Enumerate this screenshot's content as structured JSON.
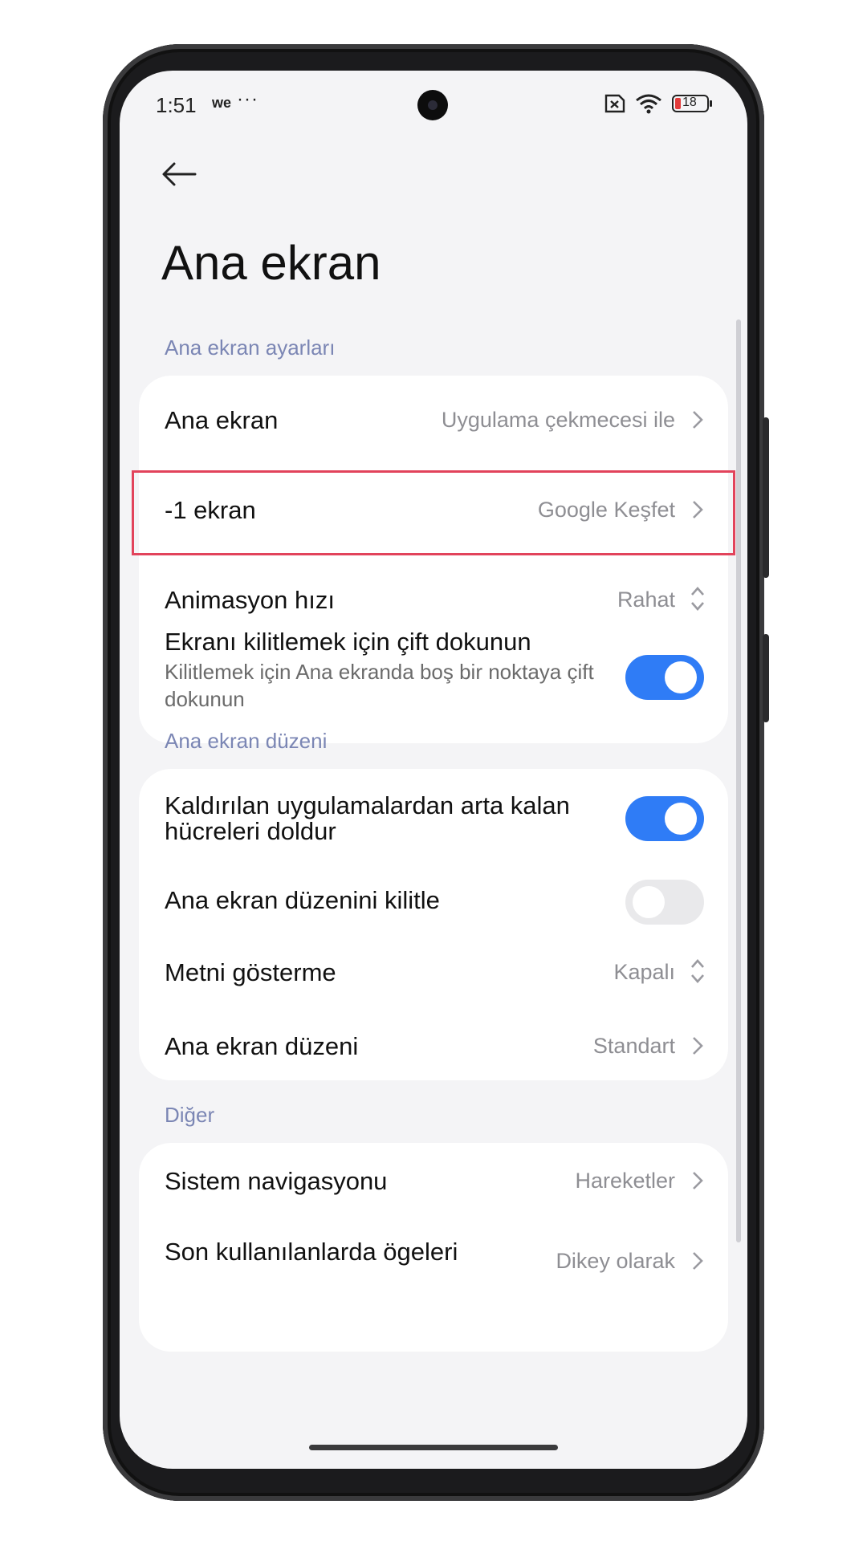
{
  "status": {
    "time": "1:51",
    "carrier_icon": "we",
    "more": "···",
    "battery": "18"
  },
  "header": {
    "title": "Ana ekran",
    "back_icon": "arrow-left-icon"
  },
  "sections": {
    "s1": "Ana ekran ayarları",
    "s2": "Ana ekran düzeni",
    "s3": "Diğer"
  },
  "card1": {
    "home": {
      "label": "Ana ekran",
      "value": "Uygulama çekmecesi ile"
    },
    "minus1": {
      "label": "-1 ekran",
      "value": "Google Keşfet"
    },
    "anim": {
      "label": "Animasyon hızı",
      "value": "Rahat"
    },
    "doubletap": {
      "label": "Ekranı kilitlemek için çift dokunun",
      "sub": "Kilitlemek için Ana ekranda boş bir noktaya çift dokunun",
      "on": true
    }
  },
  "card2": {
    "fill": {
      "label1": "Kaldırılan uygulamalardan arta kalan",
      "label2": "hücreleri doldur",
      "on": true
    },
    "lock": {
      "label": "Ana ekran düzenini kilitle",
      "on": false
    },
    "text": {
      "label": "Metni gösterme",
      "value": "Kapalı"
    },
    "layout": {
      "label": "Ana ekran düzeni",
      "value": "Standart"
    }
  },
  "card3": {
    "nav": {
      "label": "Sistem navigasyonu",
      "value": "Hareketler"
    },
    "recents": {
      "label": "Son kullanılanlarda ögeleri",
      "value": "Dikey olarak"
    }
  },
  "colors": {
    "accent": "#2f7cf6",
    "section": "#7b86b4",
    "highlight": "#e2435b"
  }
}
